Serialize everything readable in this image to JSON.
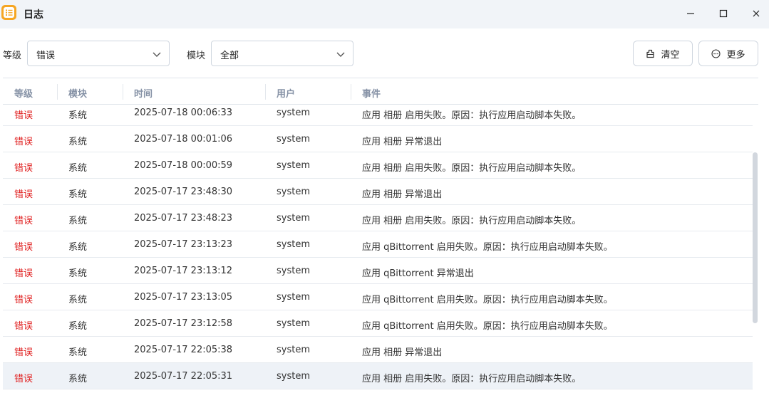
{
  "window": {
    "title": "日志",
    "icon": "log-list-icon",
    "controls": [
      "minimize-icon",
      "maximize-icon",
      "close-icon"
    ]
  },
  "filters": {
    "level_label": "等级",
    "level_value": "错误",
    "module_label": "模块",
    "module_value": "全部"
  },
  "actions": {
    "clear_label": "清空",
    "more_label": "更多"
  },
  "table": {
    "headers": [
      "等级",
      "模块",
      "时间",
      "用户",
      "事件"
    ],
    "rows": [
      {
        "level": "错误",
        "module": "系统",
        "time": "2025-07-18 00:06:33",
        "user": "system",
        "event": "应用 相册 启用失败。原因：执行应用启动脚本失败。"
      },
      {
        "level": "错误",
        "module": "系统",
        "time": "2025-07-18 00:01:06",
        "user": "system",
        "event": "应用 相册 异常退出"
      },
      {
        "level": "错误",
        "module": "系统",
        "time": "2025-07-18 00:00:59",
        "user": "system",
        "event": "应用 相册 启用失败。原因：执行应用启动脚本失败。"
      },
      {
        "level": "错误",
        "module": "系统",
        "time": "2025-07-17 23:48:30",
        "user": "system",
        "event": "应用 相册 异常退出"
      },
      {
        "level": "错误",
        "module": "系统",
        "time": "2025-07-17 23:48:23",
        "user": "system",
        "event": "应用 相册 启用失败。原因：执行应用启动脚本失败。"
      },
      {
        "level": "错误",
        "module": "系统",
        "time": "2025-07-17 23:13:23",
        "user": "system",
        "event": "应用 qBittorrent 启用失败。原因：执行应用启动脚本失败。"
      },
      {
        "level": "错误",
        "module": "系统",
        "time": "2025-07-17 23:13:12",
        "user": "system",
        "event": "应用 qBittorrent 异常退出"
      },
      {
        "level": "错误",
        "module": "系统",
        "time": "2025-07-17 23:13:05",
        "user": "system",
        "event": "应用 qBittorrent 启用失败。原因：执行应用启动脚本失败。"
      },
      {
        "level": "错误",
        "module": "系统",
        "time": "2025-07-17 23:12:58",
        "user": "system",
        "event": "应用 qBittorrent 启用失败。原因：执行应用启动脚本失败。"
      },
      {
        "level": "错误",
        "module": "系统",
        "time": "2025-07-17 22:05:38",
        "user": "system",
        "event": "应用 相册 异常退出"
      },
      {
        "level": "错误",
        "module": "系统",
        "time": "2025-07-17 22:05:31",
        "user": "system",
        "event": "应用 相册 启用失败。原因：执行应用启动脚本失败。"
      }
    ],
    "highlighted_row": 10
  },
  "colors": {
    "error": "#e02020",
    "header_text": "#8692a6",
    "titlebar_bg": "#f1f4f8",
    "app_icon": "#f6a623",
    "row_highlight": "#eef2f7"
  }
}
